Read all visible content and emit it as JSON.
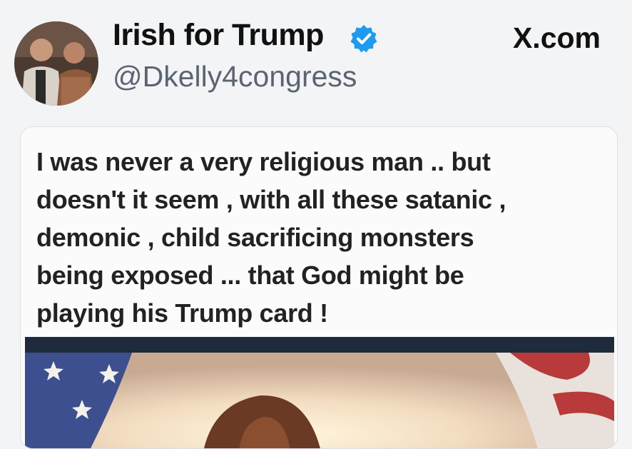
{
  "header": {
    "display_name": "Irish for Trump",
    "handle": "@Dkelly4congress",
    "brand": "X.com"
  },
  "icons": {
    "verified": "verified-badge-icon",
    "avatar": "profile-avatar"
  },
  "post": {
    "text_lines": [
      "I was never a very religious man .. but",
      "doesn't it seem , with all these satanic ,",
      "demonic , child sacrificing monsters",
      "being exposed ... that God might be",
      "playing his Trump card !"
    ]
  },
  "colors": {
    "background": "#f2f4f6",
    "verified_blue": "#1d9bf0",
    "text_dark": "#111111",
    "handle_gray": "#5b6470"
  }
}
